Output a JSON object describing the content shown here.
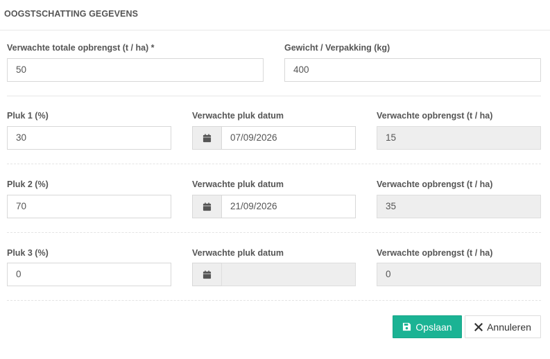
{
  "header": {
    "title": "OOGSTSCHATTING GEGEVENS"
  },
  "top": {
    "yield_label": "Verwachte totale opbrengst (t / ha) *",
    "yield_value": "50",
    "weight_label": "Gewicht / Verpakking (kg)",
    "weight_value": "400"
  },
  "picks": [
    {
      "pct_label": "Pluk 1 (%)",
      "pct_value": "30",
      "date_label": "Verwachte pluk datum",
      "date_value": "07/09/2026",
      "yield_label": "Verwachte opbrengst (t / ha)",
      "yield_value": "15"
    },
    {
      "pct_label": "Pluk 2 (%)",
      "pct_value": "70",
      "date_label": "Verwachte pluk datum",
      "date_value": "21/09/2026",
      "yield_label": "Verwachte opbrengst (t / ha)",
      "yield_value": "35"
    },
    {
      "pct_label": "Pluk 3 (%)",
      "pct_value": "0",
      "date_label": "Verwachte pluk datum",
      "date_value": "",
      "yield_label": "Verwachte opbrengst (t / ha)",
      "yield_value": "0"
    }
  ],
  "actions": {
    "save_label": "Opslaan",
    "cancel_label": "Annuleren"
  },
  "icons": {
    "calendar": "calendar-icon",
    "save": "floppy-disk-icon",
    "cancel": "close-icon"
  },
  "colors": {
    "primary": "#1bb394",
    "readonly_bg": "#eeeeee"
  }
}
